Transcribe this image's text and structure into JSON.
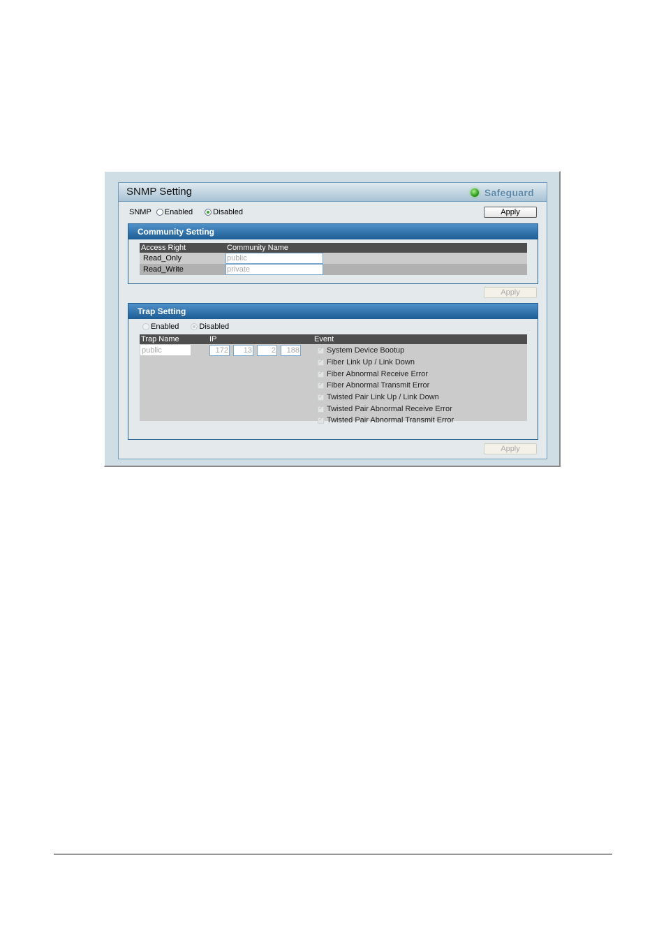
{
  "panel": {
    "title": "SNMP Setting",
    "status_label": "Safeguard",
    "status_color": "#3da33a",
    "accent_color": "#1d5c94"
  },
  "snmp": {
    "label": "SNMP",
    "enabled_label": "Enabled",
    "disabled_label": "Disabled",
    "selected": "Disabled",
    "apply_label": "Apply"
  },
  "community": {
    "title": "Community Setting",
    "columns": [
      "Access Right",
      "Community Name"
    ],
    "rows": [
      {
        "access": "Read_Only",
        "name": "public"
      },
      {
        "access": "Read_Write",
        "name": "private"
      }
    ],
    "apply_label": "Apply"
  },
  "trap": {
    "title": "Trap Setting",
    "enabled_label": "Enabled",
    "disabled_label": "Disabled",
    "selected": "Disabled",
    "columns": [
      "Trap Name",
      "IP",
      "Event"
    ],
    "trap_name": "public",
    "ip": [
      "172",
      "13",
      "2",
      "188"
    ],
    "events": [
      {
        "label": "System Device Bootup",
        "checked": true
      },
      {
        "label": "Fiber Link Up / Link Down",
        "checked": true
      },
      {
        "label": "Fiber Abnormal Receive Error",
        "checked": true
      },
      {
        "label": "Fiber Abnormal Transmit Error",
        "checked": true
      },
      {
        "label": "Twisted Pair Link Up / Link Down",
        "checked": true
      },
      {
        "label": "Twisted Pair Abnormal Receive Error",
        "checked": true
      },
      {
        "label": "Twisted Pair Abnormal Transmit Error",
        "checked": true
      }
    ],
    "apply_label": "Apply"
  }
}
